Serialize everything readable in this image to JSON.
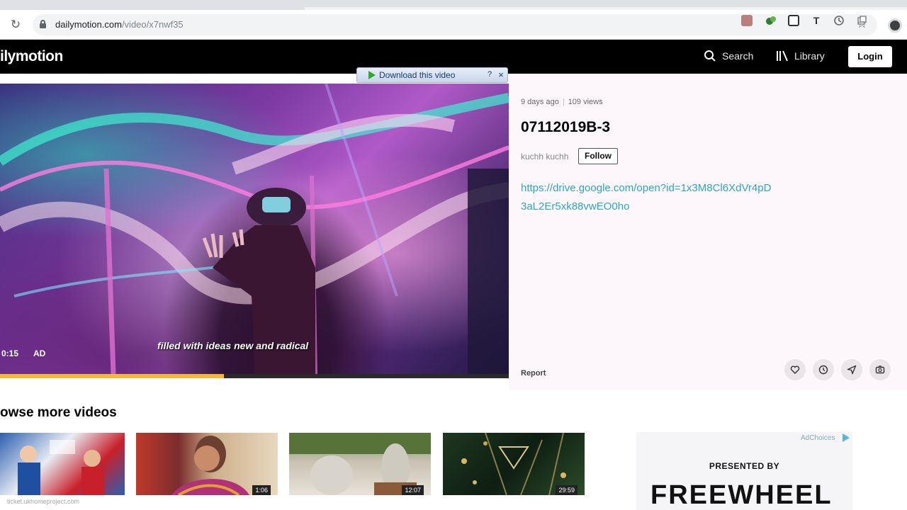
{
  "browser": {
    "url_domain": "dailymotion.com",
    "url_path": "/video/x7nwf35"
  },
  "site": {
    "logo": "ilymotion",
    "nav": {
      "search_label": "Search",
      "library_label": "Library",
      "login_label": "Login"
    }
  },
  "player": {
    "download_bar_label": "Download this video",
    "download_help": "?",
    "download_close": "×",
    "subtitle": "filled with ideas new and radical",
    "timecode": "0:15",
    "ad_label": "AD",
    "progress": 0.44
  },
  "video": {
    "posted": "9 days ago",
    "views": "109 views",
    "title": "07112019B-3",
    "channel": "kuchh kuchh",
    "follow_label": "Follow",
    "description_link": "https://drive.google.com/open?id=1x3M8Cl6XdVr4pD3aL2Er5xk88vwEO0ho",
    "report_label": "Report"
  },
  "actions": [
    {
      "name": "like-icon"
    },
    {
      "name": "watch-later-icon"
    },
    {
      "name": "share-icon"
    },
    {
      "name": "save-icon"
    }
  ],
  "browse": {
    "title": "owse more videos",
    "thumbnails": [
      {
        "duration": ""
      },
      {
        "duration": "1:06"
      },
      {
        "duration": "12:07"
      },
      {
        "duration": "29:59"
      }
    ],
    "source_text": "ticket.ukhomeproject.com"
  },
  "ad": {
    "adchoices_label": "AdChoices",
    "presented_by": "PRESENTED BY",
    "brand": "FREEWHEEL"
  },
  "colors": {
    "accent_progress": "#f3b73a",
    "link": "#2ba6c8",
    "header_bg": "#000000",
    "panel_bg": "#fdf7fc"
  }
}
